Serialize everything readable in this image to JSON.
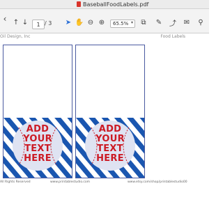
{
  "window": {
    "title": "BaseballFoodLabels.pdf"
  },
  "toolbar": {
    "page_current": "1",
    "page_total": "/ 3",
    "zoom": "65.5%",
    "tools": [
      {
        "name": "chevron-left-icon",
        "glyph": "‹"
      },
      {
        "name": "page-up-icon",
        "glyph": "↑"
      },
      {
        "name": "page-down-icon",
        "glyph": "↓"
      },
      {
        "name": "select-pointer-icon",
        "glyph": "➤"
      },
      {
        "name": "hand-tool-icon",
        "glyph": "✋"
      },
      {
        "name": "zoom-out-icon",
        "glyph": "⊖"
      },
      {
        "name": "zoom-in-icon",
        "glyph": "⊕"
      },
      {
        "name": "fit-page-icon",
        "glyph": "⧉"
      },
      {
        "name": "sign-pen-icon",
        "glyph": "✎"
      },
      {
        "name": "comment-icon",
        "glyph": "💬"
      }
    ]
  },
  "document": {
    "header_left": "Oil Design, Inc",
    "header_right": "Food Labels",
    "labels": [
      {
        "lines": [
          "ADD",
          "YOUR",
          "TEXT",
          "HERE"
        ]
      },
      {
        "lines": [
          "ADD",
          "YOUR",
          "TEXT",
          "HERE"
        ]
      }
    ],
    "footer_left": "All Rights Reserved",
    "footer_mid": "www.printablestudio.com",
    "footer_right": "www.etsy.com/shop/printablestudio00"
  },
  "colors": {
    "stripe_dark": "#1a56b0",
    "stripe_light": "#ffffff",
    "ball": "#dfe3f2",
    "stitch": "#cc1a24",
    "text": "#cc1a24"
  }
}
